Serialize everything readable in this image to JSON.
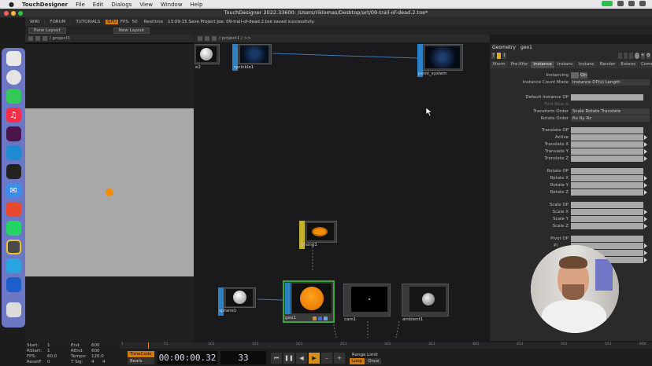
{
  "mac_menu": {
    "app": "TouchDesigner",
    "items": [
      "File",
      "Edit",
      "Dialogs",
      "View",
      "Window",
      "Help"
    ]
  },
  "window_title": "TouchDesigner 2022.33600: /Users/riklomas/Desktop/art/09-trail-of-dead.2.toe*",
  "app_menu": {
    "wiki": "WIKI",
    "forum": "FORUM",
    "tutorials": "TUTORIALS",
    "badge": "GPU",
    "fps_label": "FPS:",
    "fps": "50",
    "realtime": "Realtime",
    "message": "13:09:15 Save Project Joe: 09-trail-of-dead.2.toe saved successfully."
  },
  "toolbar": {
    "pane_layout": "Pane Layout",
    "new_layout": "New Layout"
  },
  "left_path": "/ project1",
  "net_path": "/ project1 / >>",
  "nodes": {
    "sphere2": "e2",
    "sprinkle1": "sprinkle1",
    "point_system": "point_system",
    "phong1": "phong1",
    "sphere1": "sphere1",
    "geo1": "geo1",
    "cam1": "cam1",
    "ambient1": "ambient1"
  },
  "params": {
    "op_type": "Geometry",
    "op_name": "geo1",
    "tabs": [
      "Xform",
      "Pre-Xfor",
      "Instance",
      "Instanc",
      "Instanc",
      "Render",
      "Extens",
      "Commo"
    ],
    "instancing_label": "Instancing",
    "instancing_value": "On",
    "count_mode_label": "Instance Count Mode",
    "count_mode_value": "Instance OP(s) Length",
    "default_op_label": "Default Instance OP",
    "first_row_label": "First Row is",
    "transform_order_label": "Transform Order",
    "transform_order_value": "Scale Rotate Translate",
    "rotate_order_label": "Rotate Order",
    "rotate_order_value": "Rx Ry Rz",
    "translate_op": "Translate OP",
    "active": "Active",
    "translate_x": "Translate X",
    "translate_y": "Translate Y",
    "translate_z": "Translate Z",
    "rotate_op": "Rotate OP",
    "rotate_x": "Rotate X",
    "rotate_y": "Rotate Y",
    "rotate_z": "Rotate Z",
    "scale_op": "Scale OP",
    "scale_x": "Scale X",
    "scale_y": "Scale Y",
    "scale_z": "Scale Z",
    "pivot_op": "Pivot OP",
    "pivot_x": "Pi"
  },
  "time_info": {
    "start_label": "Start:",
    "start": "1",
    "end_label": "End:",
    "end": "600",
    "rstart_label": "RStart:",
    "rstart": "1",
    "rend_label": "REnd:",
    "rend": "600",
    "fps_label": "FPS:",
    "fps": "60.0",
    "tempo_label": "Tempo:",
    "tempo": "120.0",
    "resetf_label": "ResetF:",
    "resetf": "0",
    "tsig_label": "T Sig:",
    "tsig_a": "4",
    "tsig_b": "4"
  },
  "ruler_ticks": [
    "1",
    "51",
    "101",
    "151",
    "201",
    "251",
    "301",
    "351",
    "401",
    "451",
    "501",
    "551",
    "600"
  ],
  "playbar": {
    "timecode_label": "TimeCode",
    "beats_label": "Beats",
    "timecode": "00:00:00.32",
    "frame": "33",
    "range_limit": "Range Limit",
    "loop": "Loop",
    "once": "Once"
  },
  "colors": {
    "accent": "#d07a10",
    "op_blue": "#2c80c6",
    "selected": "#3aa33a",
    "ball": "#f28c00"
  }
}
